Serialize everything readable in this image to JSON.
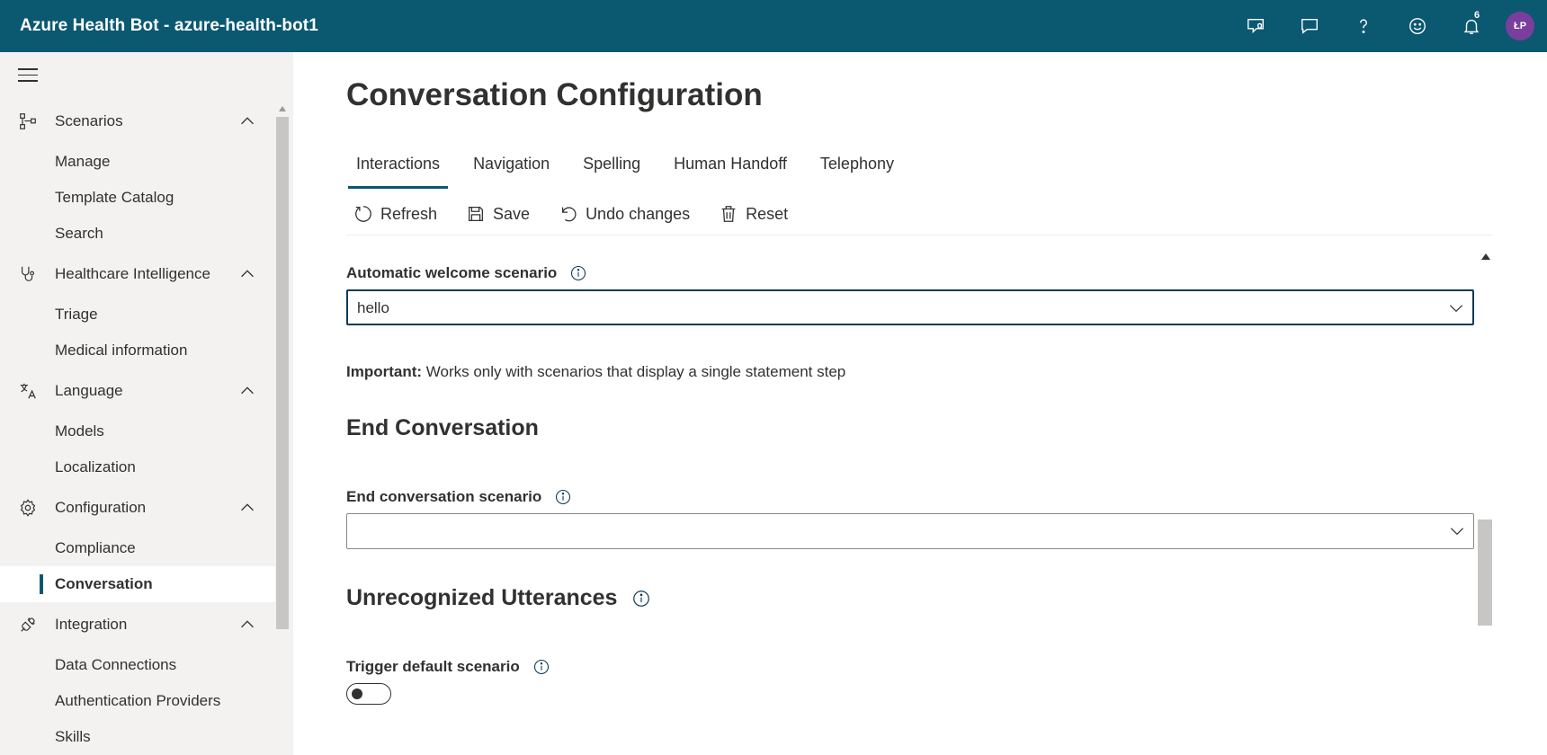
{
  "header": {
    "title": "Azure Health Bot - azure-health-bot1",
    "icons": [
      "feedback-shield-icon",
      "chat-icon",
      "help-icon",
      "smiley-icon",
      "bell-icon"
    ],
    "notification_count": "6",
    "avatar_initials": "ŁP"
  },
  "sidebar": {
    "groups": [
      {
        "label": "Scenarios",
        "icon": "flow-icon",
        "items": [
          "Manage",
          "Template Catalog",
          "Search"
        ]
      },
      {
        "label": "Healthcare Intelligence",
        "icon": "stethoscope-icon",
        "items": [
          "Triage",
          "Medical information"
        ]
      },
      {
        "label": "Language",
        "icon": "translate-icon",
        "items": [
          "Models",
          "Localization"
        ]
      },
      {
        "label": "Configuration",
        "icon": "gear-icon",
        "items": [
          "Compliance",
          "Conversation"
        ]
      },
      {
        "label": "Integration",
        "icon": "plug-icon",
        "items": [
          "Data Connections",
          "Authentication Providers",
          "Skills"
        ]
      }
    ],
    "active_item": "Conversation"
  },
  "main": {
    "title": "Conversation Configuration",
    "tabs": [
      "Interactions",
      "Navigation",
      "Spelling",
      "Human Handoff",
      "Telephony"
    ],
    "active_tab": "Interactions",
    "toolbar": {
      "refresh": "Refresh",
      "save": "Save",
      "undo": "Undo changes",
      "reset": "Reset"
    },
    "welcome": {
      "label": "Automatic welcome scenario",
      "value": "hello"
    },
    "note": {
      "bold": "Important:",
      "text": " Works only with scenarios that display a single statement step"
    },
    "end_section": "End Conversation",
    "end_field": {
      "label": "End conversation scenario",
      "value": ""
    },
    "unrecognized_section": "Unrecognized Utterances",
    "trigger_field": {
      "label": "Trigger default scenario",
      "checked": false
    }
  },
  "colors": {
    "header_bg": "#0b5871",
    "accent": "#0b5871",
    "avatar_bg": "#7a3e9d"
  }
}
